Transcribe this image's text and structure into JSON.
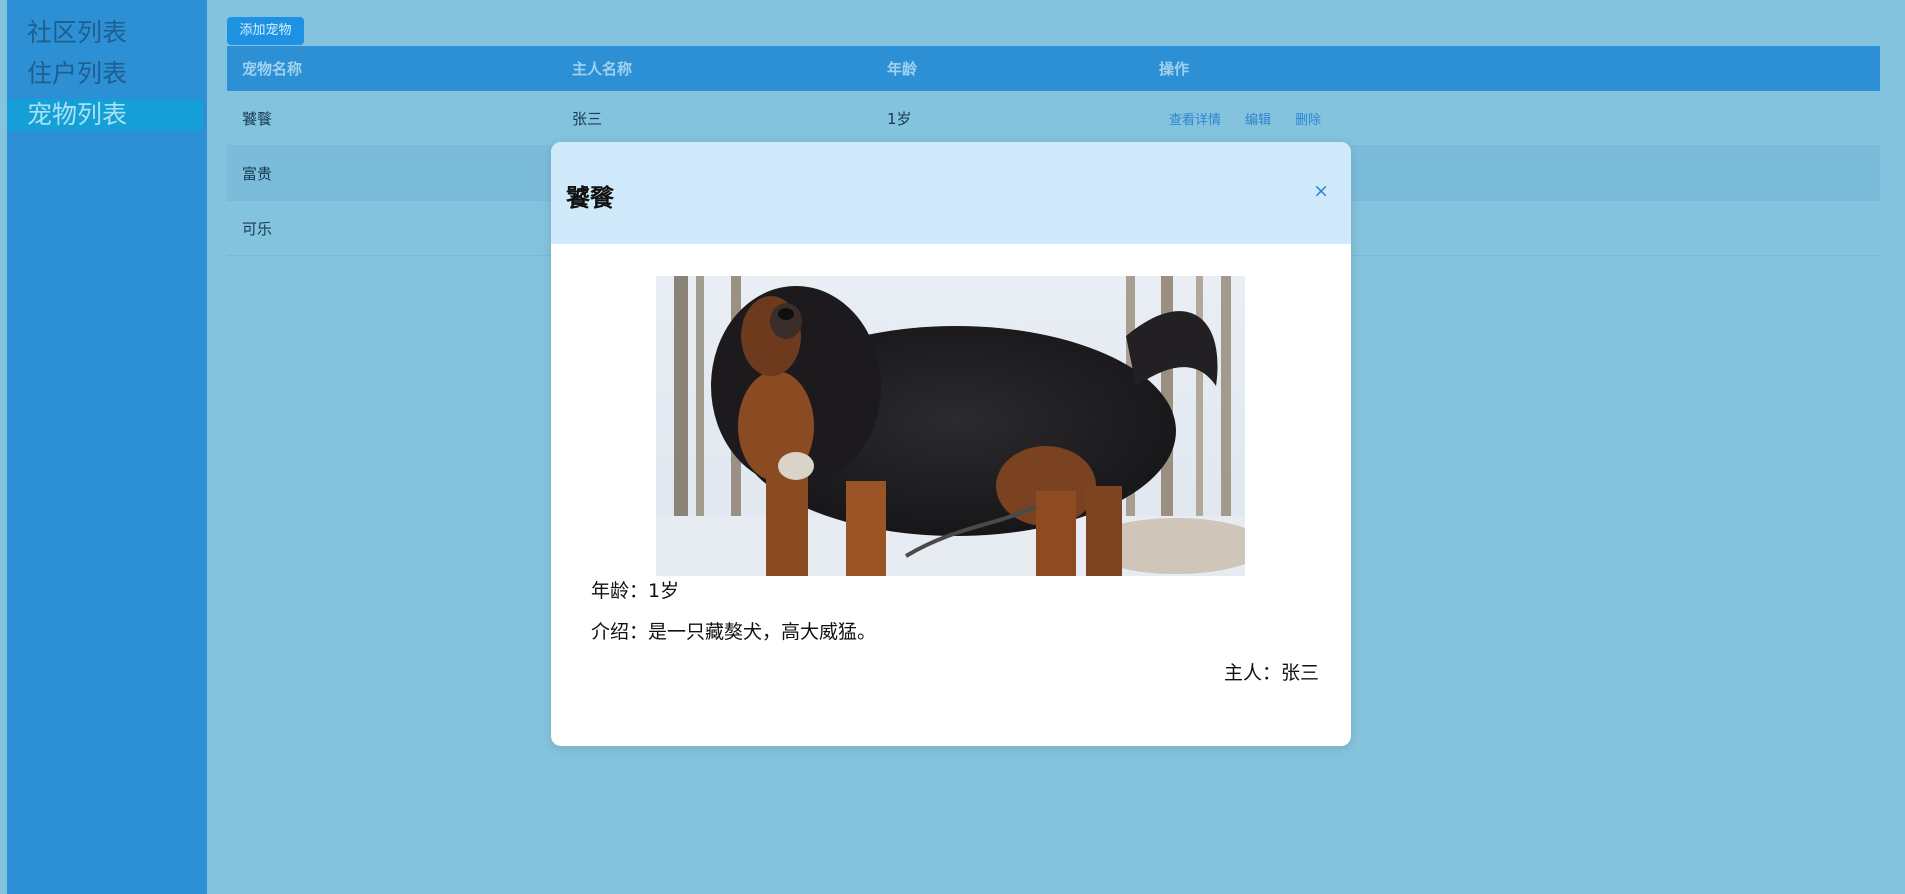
{
  "sidebar": {
    "items": [
      {
        "label": "社区列表",
        "active": false
      },
      {
        "label": "住户列表",
        "active": false
      },
      {
        "label": "宠物列表",
        "active": true
      }
    ]
  },
  "toolbar": {
    "add_label": "添加宠物"
  },
  "table": {
    "headers": [
      "宠物名称",
      "主人名称",
      "年龄",
      "操作"
    ],
    "rows": [
      {
        "name": "饕餮",
        "owner": "张三",
        "age": "1岁"
      },
      {
        "name": "富贵",
        "owner": "",
        "age": ""
      },
      {
        "name": "可乐",
        "owner": "",
        "age": ""
      }
    ],
    "actions": {
      "view": "查看详情",
      "edit": "编辑",
      "delete": "删除"
    }
  },
  "modal": {
    "title": "饕餮",
    "close_symbol": "×",
    "age_text": "年龄：1岁",
    "desc_text": "介绍：是一只藏獒犬，高大威猛。",
    "owner_text": "主人：张三"
  },
  "colors": {
    "sidebar_bg": "#2e90d4",
    "page_bg": "#84c3dd",
    "header_bg": "#2e90d4",
    "accent": "#1d92e3",
    "modal_header_bg": "#d0eafc"
  }
}
